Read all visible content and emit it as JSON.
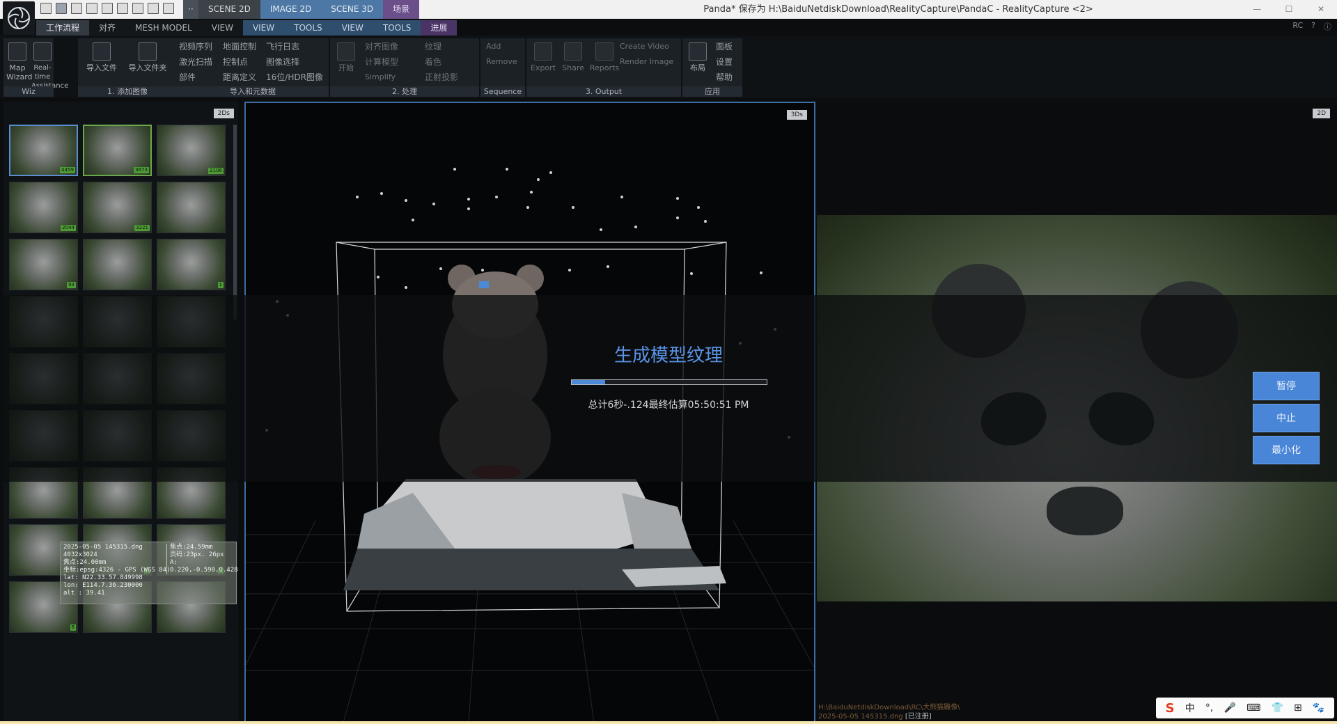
{
  "titlebar": {
    "view_tabs": [
      "SCENE 2D",
      "IMAGE 2D",
      "SCENE 3D",
      "场景"
    ],
    "window_title": "Panda* 保存为 H:\\BaiduNetdiskDownload\\RealityCapture\\PandaC - RealityCapture <2>",
    "controls": [
      "—",
      "☐",
      "✕"
    ]
  },
  "ribbon": {
    "tabs": [
      "工作流程",
      "对齐",
      "MESH MODEL",
      "VIEW",
      "VIEW",
      "TOOLS",
      "VIEW",
      "TOOLS",
      "进展"
    ],
    "right_items": [
      "RC",
      "?",
      "ⓘ"
    ],
    "groups": {
      "wiz": {
        "label": "Wiz",
        "map_wizard": "Map\nWizard",
        "realtime": "Real-time\nAssistance"
      },
      "add_images": {
        "label": "1. 添加图像",
        "import_files": "导入文件",
        "import_folder": "导入文件夹"
      },
      "import_meta": {
        "label": "导入和元数据",
        "items": [
          "视频序列",
          "地面控制",
          "飞行日志",
          "激光扫描",
          "控制点",
          "图像选择",
          "部件",
          "距离定义",
          "16位/HDR图像"
        ]
      },
      "process": {
        "label": "2. 处理",
        "start": "开始",
        "items": [
          "对齐图像",
          "纹理",
          "计算模型",
          "着色",
          "Simplify",
          "正射投影"
        ]
      },
      "sequence": {
        "label": "Sequence",
        "items": [
          "Add",
          "Remove"
        ]
      },
      "output": {
        "label": "3. Output",
        "items": [
          "Export",
          "Share",
          "Reports"
        ],
        "create_video": "Create Video",
        "render_image": "Render Image"
      },
      "apply": {
        "label": "应用",
        "layout": "布局",
        "items": [
          "面板",
          "设置",
          "帮助"
        ]
      }
    }
  },
  "panes": {
    "left_badge": "2Ds",
    "mid_badge": "3Ds",
    "right_badge": "2D"
  },
  "thumbnails": {
    "tags": [
      "4459",
      "3673",
      "2106",
      "2044",
      "3221",
      "93",
      "1",
      "",
      "",
      "8",
      "8",
      "8"
    ]
  },
  "metadata": {
    "filename": "2025-05-05 145315.dng",
    "resolution": "4032x3024",
    "focal": "焦点:24.00mm",
    "crs": "坐标:epsg:4326 - GPS (WGS 84)",
    "lat": "lat: N22.33.57.849998",
    "lon": "lon: E114.7.36.230000",
    "alt": "alt : 39.41",
    "focal35": "焦点:24.59mm",
    "pixels": "页码:23px.  26px",
    "distortion": "A: 0.220,-0.590,0.428"
  },
  "image2d": {
    "path": "H:\\BaiduNetdiskDownload\\RC\\大熊猫雕像\\",
    "file": "2025-05-05 145315.dng",
    "registered": "[已注册]"
  },
  "progress": {
    "title": "生成模型纹理",
    "fraction": 0.17,
    "status": "总计6秒-.124最终估算05:50:51 PM",
    "buttons": [
      "暂停",
      "中止",
      "最小化"
    ]
  },
  "ime": {
    "brand": "S",
    "items": [
      "中",
      "°,",
      "🎤",
      "⌨",
      "👕",
      "⊞",
      "🐾"
    ]
  },
  "colors": {
    "accent": "#4a86d8",
    "active_pane_border": "#3d6da3",
    "title_text": "#5a93e6"
  }
}
